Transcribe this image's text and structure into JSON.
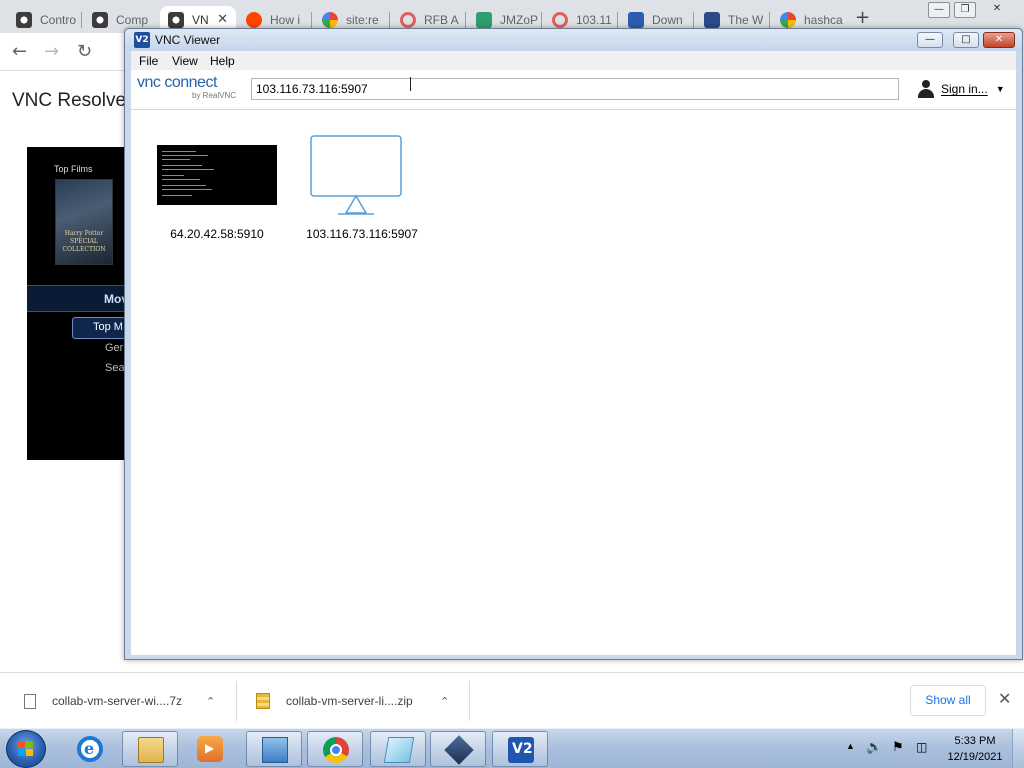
{
  "browser": {
    "tabs": [
      {
        "label": "Contro",
        "favicon_color": "#3c3c3c"
      },
      {
        "label": "Comp",
        "favicon_color": "#3c3c3c"
      },
      {
        "label": "VN",
        "favicon_color": "#3c3c3c"
      },
      {
        "label": "How i",
        "favicon_color": "#ff4500"
      },
      {
        "label": "site:re",
        "favicon_color": "#4285f4"
      },
      {
        "label": "RFB A",
        "favicon_color": "#e06060"
      },
      {
        "label": "JMZoP",
        "favicon_color": "#2e9e6e"
      },
      {
        "label": "103.11",
        "favicon_color": "#e06060"
      },
      {
        "label": "Down",
        "favicon_color": "#2a5db0"
      },
      {
        "label": "The W",
        "favicon_color": "#2a4a8a"
      },
      {
        "label": "hashca",
        "favicon_color": "#4285f4"
      }
    ],
    "new_tab": "+",
    "close_tab": "✕"
  },
  "background_page": {
    "title": "VNC Resolve",
    "media": {
      "section": "Top Films",
      "poster_text": "Harry Potter\nSPECIAL\nCOLLECTION",
      "band_label": "Mov",
      "selected_item": "Top M",
      "item_2": "Ger",
      "item_3": "Sea"
    }
  },
  "vnc_viewer": {
    "window_title": "VNC Viewer",
    "app_icon": "V2",
    "menus": [
      "File",
      "View",
      "Help"
    ],
    "logo_main": "vnc connect",
    "logo_sub": "by RealVNC",
    "address_value": "103.116.73.116:5907",
    "sign_in": "Sign in...",
    "connections": [
      {
        "label": "64.20.42.58:5910",
        "kind": "screenshot"
      },
      {
        "label": "103.116.73.116:5907",
        "kind": "monitor"
      }
    ],
    "accent": "#2563ae",
    "monitor_color": "#5aa0d8"
  },
  "downloads": {
    "items": [
      {
        "name": "collab-vm-server-wi....7z",
        "icon": "file-icon"
      },
      {
        "name": "collab-vm-server-li....zip",
        "icon": "zip-icon"
      }
    ],
    "show_all": "Show all",
    "close": "✕"
  },
  "taskbar": {
    "apps": [
      "internet-explorer-icon",
      "file-explorer-icon",
      "media-player-icon",
      "control-panel-icon",
      "chrome-icon",
      "notepad-icon",
      "virtualbox-icon",
      "vnc-viewer-icon"
    ],
    "time": "5:33 PM",
    "date": "12/19/2021"
  }
}
